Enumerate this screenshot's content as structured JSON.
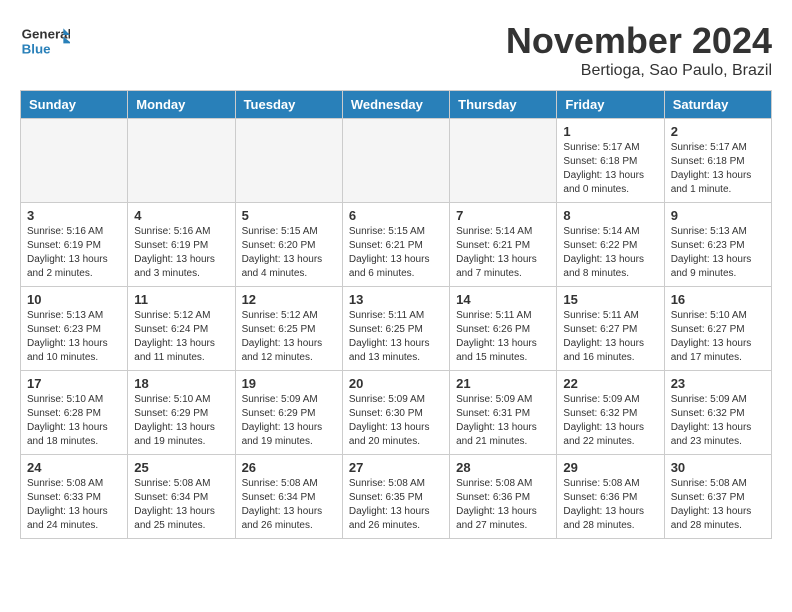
{
  "header": {
    "logo_line1": "General",
    "logo_line2": "Blue",
    "month_title": "November 2024",
    "location": "Bertioga, Sao Paulo, Brazil"
  },
  "days_of_week": [
    "Sunday",
    "Monday",
    "Tuesday",
    "Wednesday",
    "Thursday",
    "Friday",
    "Saturday"
  ],
  "weeks": [
    [
      {
        "day": "",
        "info": ""
      },
      {
        "day": "",
        "info": ""
      },
      {
        "day": "",
        "info": ""
      },
      {
        "day": "",
        "info": ""
      },
      {
        "day": "",
        "info": ""
      },
      {
        "day": "1",
        "info": "Sunrise: 5:17 AM\nSunset: 6:18 PM\nDaylight: 13 hours and 0 minutes."
      },
      {
        "day": "2",
        "info": "Sunrise: 5:17 AM\nSunset: 6:18 PM\nDaylight: 13 hours and 1 minute."
      }
    ],
    [
      {
        "day": "3",
        "info": "Sunrise: 5:16 AM\nSunset: 6:19 PM\nDaylight: 13 hours and 2 minutes."
      },
      {
        "day": "4",
        "info": "Sunrise: 5:16 AM\nSunset: 6:19 PM\nDaylight: 13 hours and 3 minutes."
      },
      {
        "day": "5",
        "info": "Sunrise: 5:15 AM\nSunset: 6:20 PM\nDaylight: 13 hours and 4 minutes."
      },
      {
        "day": "6",
        "info": "Sunrise: 5:15 AM\nSunset: 6:21 PM\nDaylight: 13 hours and 6 minutes."
      },
      {
        "day": "7",
        "info": "Sunrise: 5:14 AM\nSunset: 6:21 PM\nDaylight: 13 hours and 7 minutes."
      },
      {
        "day": "8",
        "info": "Sunrise: 5:14 AM\nSunset: 6:22 PM\nDaylight: 13 hours and 8 minutes."
      },
      {
        "day": "9",
        "info": "Sunrise: 5:13 AM\nSunset: 6:23 PM\nDaylight: 13 hours and 9 minutes."
      }
    ],
    [
      {
        "day": "10",
        "info": "Sunrise: 5:13 AM\nSunset: 6:23 PM\nDaylight: 13 hours and 10 minutes."
      },
      {
        "day": "11",
        "info": "Sunrise: 5:12 AM\nSunset: 6:24 PM\nDaylight: 13 hours and 11 minutes."
      },
      {
        "day": "12",
        "info": "Sunrise: 5:12 AM\nSunset: 6:25 PM\nDaylight: 13 hours and 12 minutes."
      },
      {
        "day": "13",
        "info": "Sunrise: 5:11 AM\nSunset: 6:25 PM\nDaylight: 13 hours and 13 minutes."
      },
      {
        "day": "14",
        "info": "Sunrise: 5:11 AM\nSunset: 6:26 PM\nDaylight: 13 hours and 15 minutes."
      },
      {
        "day": "15",
        "info": "Sunrise: 5:11 AM\nSunset: 6:27 PM\nDaylight: 13 hours and 16 minutes."
      },
      {
        "day": "16",
        "info": "Sunrise: 5:10 AM\nSunset: 6:27 PM\nDaylight: 13 hours and 17 minutes."
      }
    ],
    [
      {
        "day": "17",
        "info": "Sunrise: 5:10 AM\nSunset: 6:28 PM\nDaylight: 13 hours and 18 minutes."
      },
      {
        "day": "18",
        "info": "Sunrise: 5:10 AM\nSunset: 6:29 PM\nDaylight: 13 hours and 19 minutes."
      },
      {
        "day": "19",
        "info": "Sunrise: 5:09 AM\nSunset: 6:29 PM\nDaylight: 13 hours and 19 minutes."
      },
      {
        "day": "20",
        "info": "Sunrise: 5:09 AM\nSunset: 6:30 PM\nDaylight: 13 hours and 20 minutes."
      },
      {
        "day": "21",
        "info": "Sunrise: 5:09 AM\nSunset: 6:31 PM\nDaylight: 13 hours and 21 minutes."
      },
      {
        "day": "22",
        "info": "Sunrise: 5:09 AM\nSunset: 6:32 PM\nDaylight: 13 hours and 22 minutes."
      },
      {
        "day": "23",
        "info": "Sunrise: 5:09 AM\nSunset: 6:32 PM\nDaylight: 13 hours and 23 minutes."
      }
    ],
    [
      {
        "day": "24",
        "info": "Sunrise: 5:08 AM\nSunset: 6:33 PM\nDaylight: 13 hours and 24 minutes."
      },
      {
        "day": "25",
        "info": "Sunrise: 5:08 AM\nSunset: 6:34 PM\nDaylight: 13 hours and 25 minutes."
      },
      {
        "day": "26",
        "info": "Sunrise: 5:08 AM\nSunset: 6:34 PM\nDaylight: 13 hours and 26 minutes."
      },
      {
        "day": "27",
        "info": "Sunrise: 5:08 AM\nSunset: 6:35 PM\nDaylight: 13 hours and 26 minutes."
      },
      {
        "day": "28",
        "info": "Sunrise: 5:08 AM\nSunset: 6:36 PM\nDaylight: 13 hours and 27 minutes."
      },
      {
        "day": "29",
        "info": "Sunrise: 5:08 AM\nSunset: 6:36 PM\nDaylight: 13 hours and 28 minutes."
      },
      {
        "day": "30",
        "info": "Sunrise: 5:08 AM\nSunset: 6:37 PM\nDaylight: 13 hours and 28 minutes."
      }
    ]
  ]
}
